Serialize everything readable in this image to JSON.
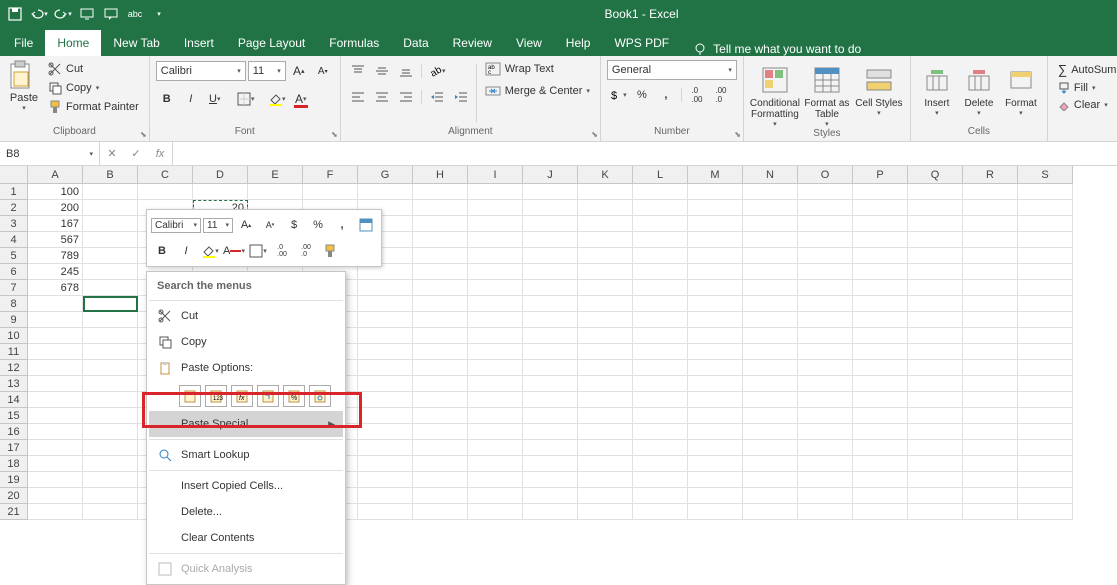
{
  "title": "Book1  -  Excel",
  "tabs": [
    "File",
    "Home",
    "New Tab",
    "Insert",
    "Page Layout",
    "Formulas",
    "Data",
    "Review",
    "View",
    "Help",
    "WPS PDF"
  ],
  "active_tab": "Home",
  "tell_me": "Tell me what you want to do",
  "clipboard": {
    "paste": "Paste",
    "cut": "Cut",
    "copy": "Copy",
    "format_painter": "Format Painter",
    "label": "Clipboard"
  },
  "font": {
    "name": "Calibri",
    "size": "11",
    "label": "Font"
  },
  "alignment": {
    "wrap": "Wrap Text",
    "merge": "Merge & Center",
    "label": "Alignment"
  },
  "number": {
    "format": "General",
    "label": "Number"
  },
  "styles": {
    "cond": "Conditional Formatting",
    "table": "Format as Table",
    "cell": "Cell Styles",
    "label": "Styles"
  },
  "cells": {
    "insert": "Insert",
    "delete": "Delete",
    "format": "Format",
    "label": "Cells"
  },
  "editing": {
    "autosum": "AutoSum",
    "fill": "Fill",
    "clear": "Clear"
  },
  "name_box": "B8",
  "columns": [
    "A",
    "B",
    "C",
    "D",
    "E",
    "F",
    "G",
    "H",
    "I",
    "J",
    "K",
    "L",
    "M",
    "N",
    "O",
    "P",
    "Q",
    "R",
    "S"
  ],
  "row_count": 21,
  "cell_data": {
    "A1": "100",
    "A2": "200",
    "A3": "167",
    "A4": "567",
    "A5": "789",
    "A6": "245",
    "A7": "678",
    "D2": "20"
  },
  "mini_toolbar": {
    "font": "Calibri",
    "size": "11"
  },
  "context_menu": {
    "search": "Search the menus",
    "cut": "Cut",
    "copy": "Copy",
    "paste_options": "Paste Options:",
    "paste_special": "Paste Special...",
    "smart_lookup": "Smart Lookup",
    "insert_copied": "Insert Copied Cells...",
    "delete": "Delete...",
    "clear": "Clear Contents",
    "quick_analysis": "Quick Analysis"
  }
}
